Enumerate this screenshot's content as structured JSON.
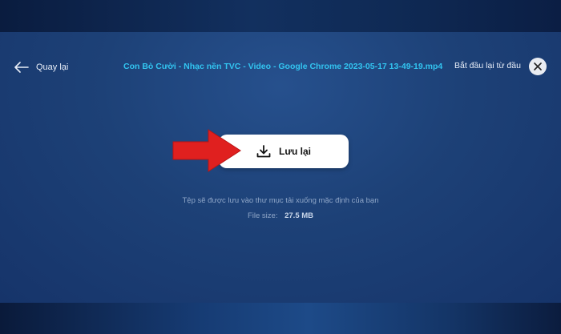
{
  "header": {
    "back_label": "Quay lại",
    "file_title": "Con Bò Cười - Nhạc nền TVC - Video - Google Chrome 2023-05-17 13-49-19.mp4",
    "restart_label": "Bắt đầu lại từ đầu"
  },
  "main": {
    "save_label": "Lưu lại",
    "info_text": "Tệp sẽ được lưu vào thư mục tải xuống mặc định của bạn",
    "file_size_label": "File size:",
    "file_size_value": "27.5 MB"
  },
  "icons": {
    "back": "arrow-left-icon",
    "close": "close-icon",
    "download": "download-icon",
    "annotation": "red-arrow-icon"
  },
  "colors": {
    "title_accent": "#32c4f0",
    "annotation_arrow": "#e0201f",
    "panel": "#1d4177"
  }
}
